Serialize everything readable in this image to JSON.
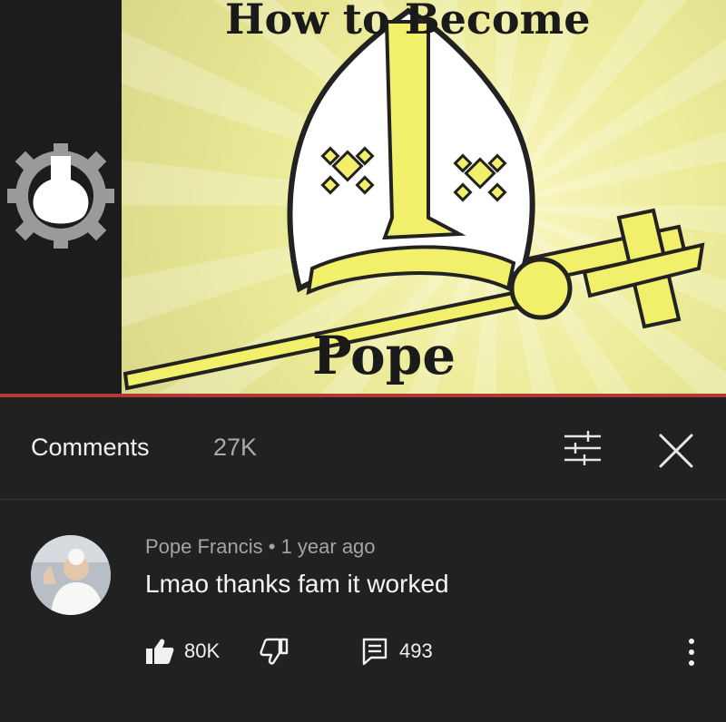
{
  "video": {
    "title_top": "How to Become",
    "title_bottom": "Pope",
    "progress_fraction": 1.0
  },
  "comments_panel": {
    "title": "Comments",
    "count": "27K",
    "filter_icon": "filter-sliders-icon",
    "close_icon": "close-icon"
  },
  "comment": {
    "author": "Pope Francis",
    "separator": " • ",
    "time": "1 year ago",
    "text": "Lmao thanks fam it worked",
    "likes": "80K",
    "replies": "493",
    "like_icon": "thumbs-up-icon",
    "dislike_icon": "thumbs-down-icon",
    "reply_icon": "reply-icon",
    "more_icon": "more-vertical-icon"
  },
  "colors": {
    "background": "#212121",
    "progress": "#b23a36",
    "mitre_yellow": "#f2ef6a"
  }
}
